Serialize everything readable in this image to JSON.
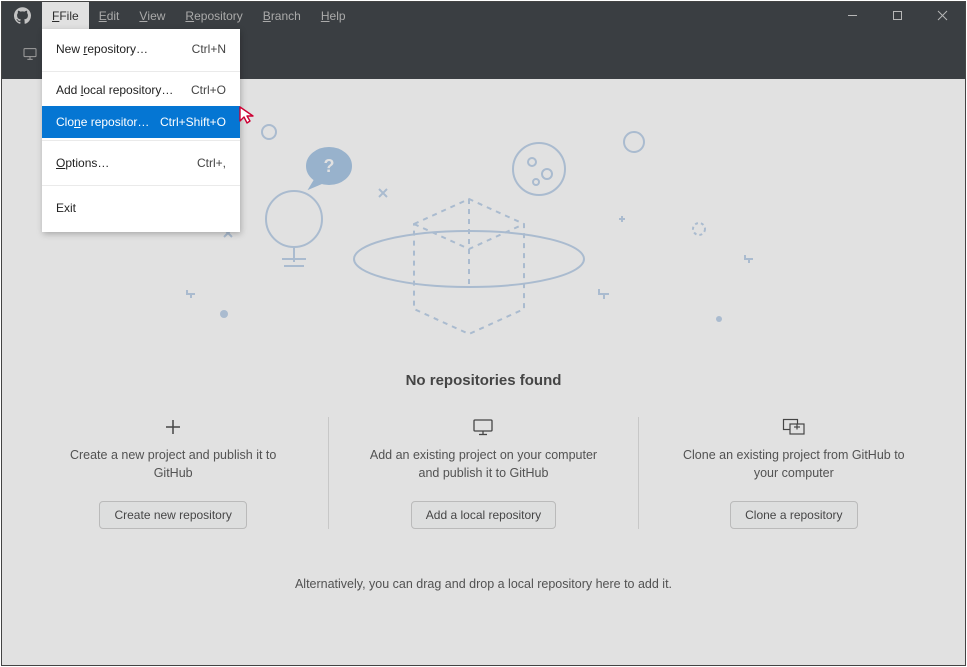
{
  "menubar": {
    "file": "File",
    "edit": "Edit",
    "view": "View",
    "repository": "Repository",
    "branch": "Branch",
    "help": "Help"
  },
  "file_menu": {
    "new_repo": {
      "label": "New repository…",
      "shortcut": "Ctrl+N",
      "ul": "r"
    },
    "add_local": {
      "label": "Add local repository…",
      "shortcut": "Ctrl+O",
      "ul": "l"
    },
    "clone": {
      "label": "Clone repositor…",
      "shortcut": "Ctrl+Shift+O",
      "ul": "n"
    },
    "options": {
      "label": "Options…",
      "shortcut": "Ctrl+,",
      "ul": "O"
    },
    "exit": {
      "label": "Exit",
      "shortcut": ""
    }
  },
  "main": {
    "heading": "No repositories found",
    "alt_text": "Alternatively, you can drag and drop a local repository here to add it."
  },
  "cards": {
    "create": {
      "desc": "Create a new project and publish it to GitHub",
      "button": "Create new repository"
    },
    "add": {
      "desc": "Add an existing project on your computer and publish it to GitHub",
      "button": "Add a local repository"
    },
    "clone": {
      "desc": "Clone an existing project from GitHub to your computer",
      "button": "Clone a repository"
    }
  }
}
